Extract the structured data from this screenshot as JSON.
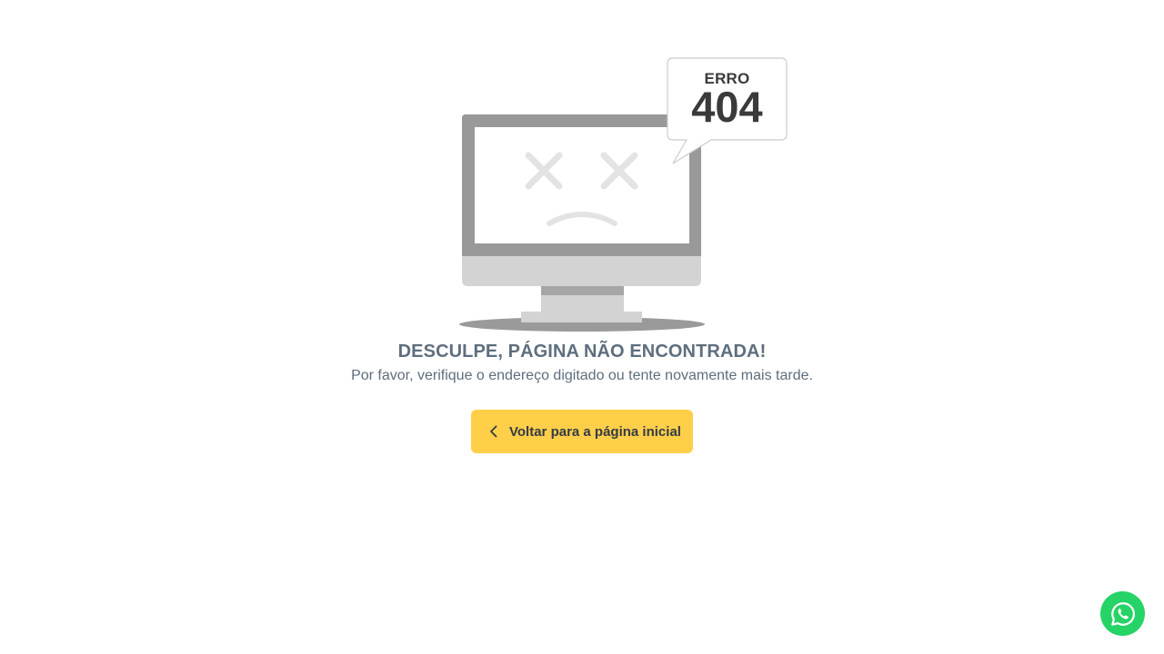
{
  "error": {
    "label": "ERRO",
    "code": "404"
  },
  "message": {
    "title": "DESCULPE, PÁGINA NÃO ENCONTRADA!",
    "subtitle": "Por favor, verifique o endereço digitado ou tente novamente mais tarde."
  },
  "actions": {
    "back_label": "Voltar para a página inicial",
    "back_icon": "chevron-left-icon"
  },
  "floating": {
    "whatsapp_icon": "whatsapp-icon"
  },
  "colors": {
    "button_bg": "#ffcf4a",
    "text_muted": "#5e6e7e",
    "whatsapp_green": "#25d366"
  }
}
